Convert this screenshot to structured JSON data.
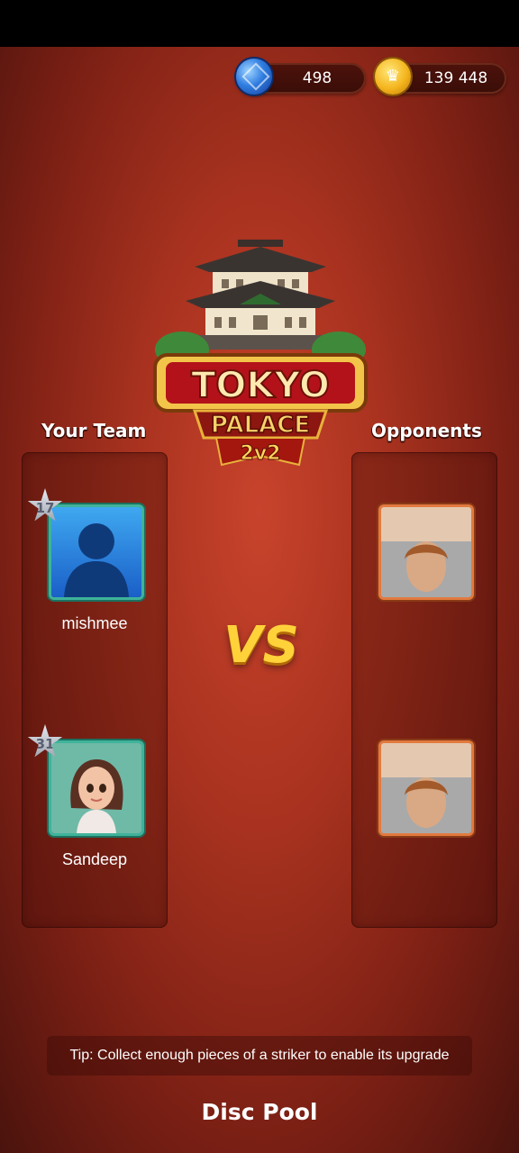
{
  "currency": {
    "gems": "498",
    "coins": "139 448"
  },
  "logo": {
    "line1": "TOKYO",
    "line2": "PALACE",
    "line3": "2v2"
  },
  "your_team": {
    "title": "Your Team",
    "players": [
      {
        "name": "mishmee",
        "level": "17"
      },
      {
        "name": "Sandeep",
        "level": "31"
      }
    ]
  },
  "opponents": {
    "title": "Opponents"
  },
  "vs_label": "VS",
  "tip": "Tip: Collect enough pieces of a striker to enable its upgrade",
  "footer": "Disc Pool",
  "colors": {
    "background": "#a8321f",
    "vs": "#ffd23a",
    "team_border": "#3fb39a",
    "opponent_border": "#e27a3f"
  }
}
